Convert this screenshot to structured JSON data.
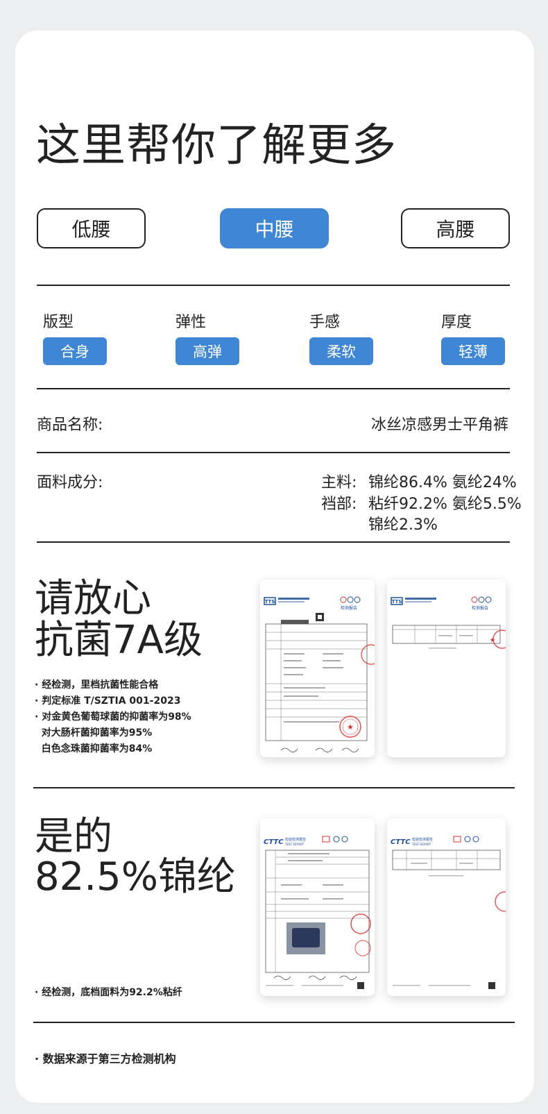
{
  "header": {
    "title": "这里帮你了解更多"
  },
  "waist": {
    "options": [
      "低腰",
      "中腰",
      "高腰"
    ],
    "selected": "中腰"
  },
  "attributes": [
    {
      "label": "版型",
      "value": "合身"
    },
    {
      "label": "弹性",
      "value": "高弹"
    },
    {
      "label": "手感",
      "value": "柔软"
    },
    {
      "label": "厚度",
      "value": "轻薄"
    }
  ],
  "product": {
    "name_label": "商品名称:",
    "name_value": "冰丝凉感男士平角裤",
    "fabric_label": "面料成分:",
    "main_label": "主料:",
    "main_value": "锦纶86.4% 氨纶24%",
    "crotch_label": "裆部:",
    "crotch_value_1": "粘纤92.2% 氨纶5.5%",
    "crotch_value_2": "锦纶2.3%"
  },
  "antibacterial": {
    "heading_1": "请放心",
    "heading_2": "抗菌7A级",
    "notes": [
      "· 经检测，里档抗菌性能合格",
      "· 判定标准 T/SZTIA 001-2023",
      "· 对金黄色葡萄球菌的抑菌率为98%",
      "  对大肠杆菌抑菌率为95%",
      "  白色念珠菌抑菌率为84%"
    ],
    "report_logo": "TTS",
    "report_title": "检测报告"
  },
  "nylon": {
    "heading_1": "是的",
    "heading_2": "82.5%锦纶",
    "note": "· 经检测，底档面料为92.2%粘纤",
    "report_logo": "CTTC",
    "report_title": "检验检测报告",
    "report_subtitle": "TEST REPORT"
  },
  "footer": {
    "note": "· 数据来源于第三方检测机构"
  },
  "colors": {
    "accent": "#3f86d4",
    "stamp": "#d9302c",
    "text": "#222222",
    "background": "#eceef0"
  }
}
